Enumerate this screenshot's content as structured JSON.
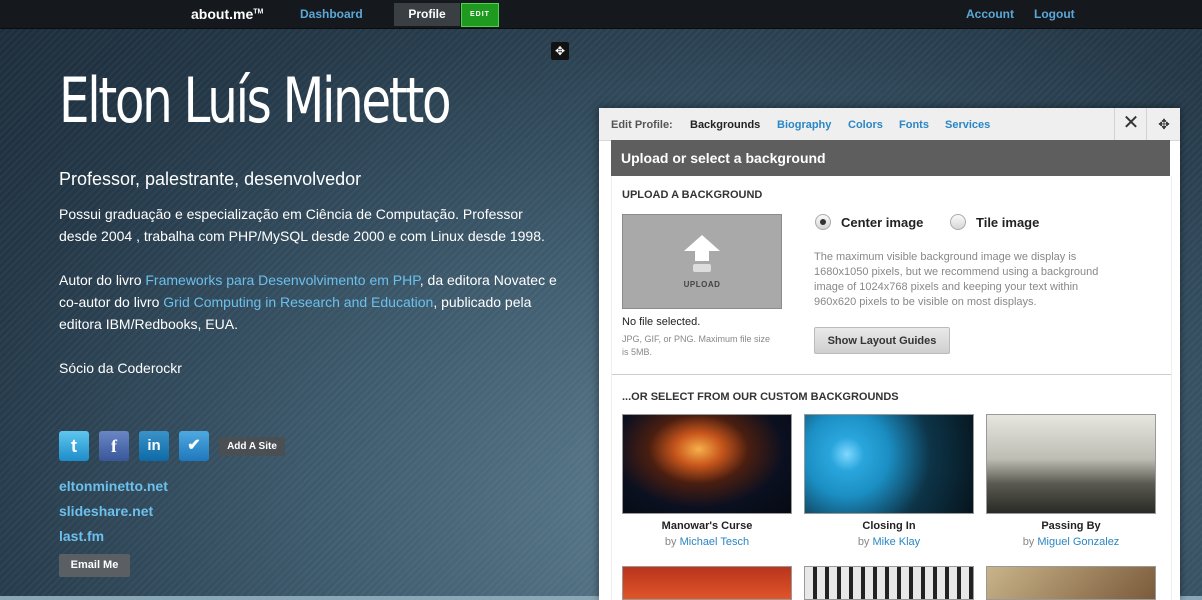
{
  "nav": {
    "logo": "about.me",
    "logo_tm": "TM",
    "dashboard": "Dashboard",
    "profile": "Profile",
    "edit": "EDIT",
    "account": "Account",
    "logout": "Logout"
  },
  "profile": {
    "name": "Elton Luís Minetto",
    "headline": "Professor, palestrante, desenvolvedor",
    "bio_p1": "Possui graduação e especialização em Ciência de Computação. Professor desde 2004 , trabalha com PHP/MySQL desde 2000 e com Linux desde 1998.",
    "bio_p2_a": "Autor do livro ",
    "bio_p2_link1": "Frameworks para Desenvolvimento em PHP",
    "bio_p2_b": ", da editora Novatec e co-autor do livro ",
    "bio_p2_link2": "Grid Computing in Research and Education",
    "bio_p2_c": ", publicado pela editora IBM/Redbooks, EUA.",
    "bio_p3": "Sócio da Coderockr",
    "social_icons": [
      "twitter-icon",
      "facebook-icon",
      "linkedin-icon",
      "foursquare-icon"
    ],
    "add_site": "Add A Site",
    "links": [
      "eltonminetto.net",
      "slideshare.net",
      "last.fm"
    ],
    "email_button": "Email Me"
  },
  "panel": {
    "tab_prefix": "Edit Profile:",
    "tabs": [
      "Backgrounds",
      "Biography",
      "Colors",
      "Fonts",
      "Services"
    ],
    "active_tab": "Backgrounds",
    "section_title": "Upload or select a background",
    "upload_heading": "UPLOAD A BACKGROUND",
    "upload_label": "UPLOAD",
    "no_file": "No file selected.",
    "file_hint": "JPG, GIF, or PNG. Maximum file size is 5MB.",
    "radio_center": "Center image",
    "radio_tile": "Tile image",
    "selected_option": "Center image",
    "bg_info": "The maximum visible background image we display is 1680x1050 pixels, but we recommend using a background image of 1024x768 pixels and keeping your text within 960x620 pixels to be visible on most displays.",
    "layout_button": "Show Layout Guides",
    "custom_heading": "...OR SELECT FROM OUR CUSTOM BACKGROUNDS",
    "by": "by",
    "backgrounds": [
      {
        "title": "Manowar's Curse",
        "author": "Michael Tesch"
      },
      {
        "title": "Closing In",
        "author": "Mike Klay"
      },
      {
        "title": "Passing By",
        "author": "Miguel Gonzalez"
      }
    ]
  },
  "colors": {
    "link": "#6cc0ec",
    "nav_link": "#5ba8d8",
    "edit_green": "#1e9a1e",
    "tab_link": "#2a86c4"
  }
}
